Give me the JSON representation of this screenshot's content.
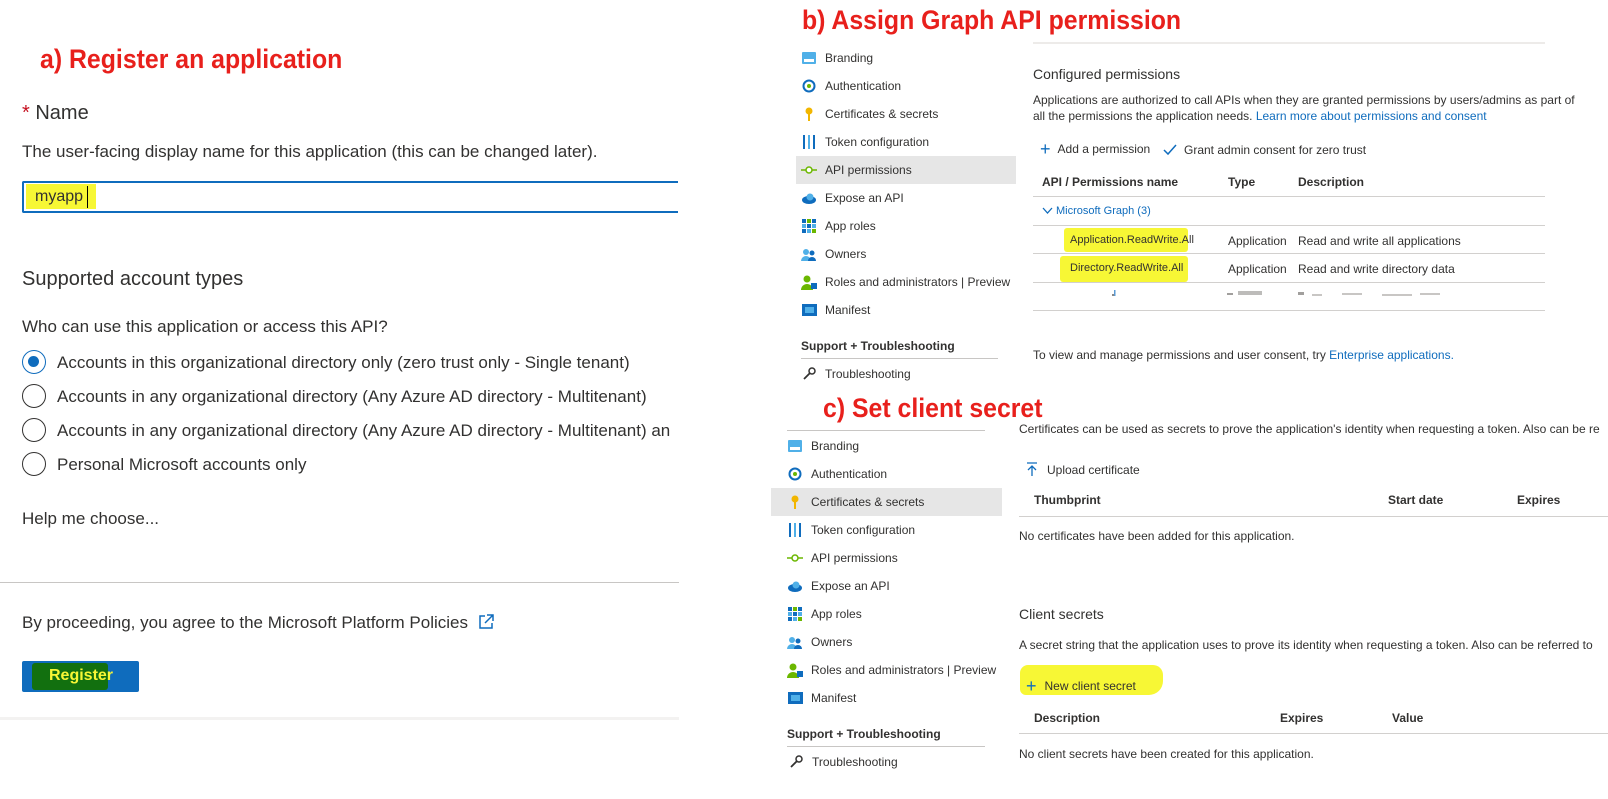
{
  "panel_a": {
    "title": "a) Register an application",
    "name_required_star": "*",
    "name_label": "Name",
    "name_help": "The user-facing display name for this application (this can be changed later).",
    "name_value": "myapp",
    "account_types_heading": "Supported account types",
    "account_types_question": "Who can use this application or access this API?",
    "account_options": [
      {
        "label": "Accounts in this organizational directory only (zero trust only - Single tenant)",
        "checked": true
      },
      {
        "label": "Accounts in any organizational directory (Any Azure AD directory - Multitenant)",
        "checked": false
      },
      {
        "label": "Accounts in any organizational directory (Any Azure AD directory - Multitenant) an",
        "checked": false
      },
      {
        "label": "Personal Microsoft accounts only",
        "checked": false
      }
    ],
    "help_link": "Help me choose...",
    "policy_text": "By proceeding, you agree to the Microsoft Platform Policies",
    "register_label": "Register"
  },
  "panel_b": {
    "title": "b) Assign Graph API permission",
    "nav_items": [
      {
        "label": "Branding",
        "icon": "branding-icon",
        "selected": false
      },
      {
        "label": "Authentication",
        "icon": "authentication-icon",
        "selected": false
      },
      {
        "label": "Certificates & secrets",
        "icon": "key-icon",
        "selected": false
      },
      {
        "label": "Token configuration",
        "icon": "token-icon",
        "selected": false
      },
      {
        "label": "API permissions",
        "icon": "api-permissions-icon",
        "selected": true
      },
      {
        "label": "Expose an API",
        "icon": "cloud-icon",
        "selected": false
      },
      {
        "label": "App roles",
        "icon": "app-roles-icon",
        "selected": false
      },
      {
        "label": "Owners",
        "icon": "owners-icon",
        "selected": false
      },
      {
        "label": "Roles and administrators | Preview",
        "icon": "roles-icon",
        "selected": false
      },
      {
        "label": "Manifest",
        "icon": "manifest-icon",
        "selected": false
      }
    ],
    "support_heading": "Support + Troubleshooting",
    "troubleshooting": "Troubleshooting",
    "configured_title": "Configured permissions",
    "configured_desc_1": "Applications are authorized to call APIs when they are granted permissions by users/admins as part of",
    "configured_desc_2": "all the permissions the application needs.",
    "learn_more": "Learn more about permissions and consent",
    "add_permission": "Add a permission",
    "grant_consent": "Grant admin consent for zero trust",
    "col_name": "API / Permissions name",
    "col_type": "Type",
    "col_desc": "Description",
    "group": "Microsoft Graph (3)",
    "permissions": [
      {
        "name": "Application.ReadWrite.All",
        "type": "Application",
        "desc": "Read and write all applications"
      },
      {
        "name": "Directory.ReadWrite.All",
        "type": "Application",
        "desc": "Read and write directory data"
      }
    ],
    "footer_text": "To view and manage permissions and user consent, try",
    "footer_link": "Enterprise applications."
  },
  "panel_c": {
    "title": "c) Set client secret",
    "nav_items": [
      {
        "label": "Branding",
        "icon": "branding-icon",
        "selected": false
      },
      {
        "label": "Authentication",
        "icon": "authentication-icon",
        "selected": false
      },
      {
        "label": "Certificates & secrets",
        "icon": "key-icon",
        "selected": true
      },
      {
        "label": "Token configuration",
        "icon": "token-icon",
        "selected": false
      },
      {
        "label": "API permissions",
        "icon": "api-permissions-icon",
        "selected": false
      },
      {
        "label": "Expose an API",
        "icon": "cloud-icon",
        "selected": false
      },
      {
        "label": "App roles",
        "icon": "app-roles-icon",
        "selected": false
      },
      {
        "label": "Owners",
        "icon": "owners-icon",
        "selected": false
      },
      {
        "label": "Roles and administrators | Preview",
        "icon": "roles-icon",
        "selected": false
      },
      {
        "label": "Manifest",
        "icon": "manifest-icon",
        "selected": false
      }
    ],
    "support_heading": "Support + Troubleshooting",
    "troubleshooting": "Troubleshooting",
    "cert_desc": "Certificates can be used as secrets to prove the application's identity when requesting a token. Also can be re",
    "upload_certificate": "Upload certificate",
    "cert_cols": [
      "Thumbprint",
      "Start date",
      "Expires"
    ],
    "no_certs": "No certificates have been added for this application.",
    "secrets_title": "Client secrets",
    "secrets_desc": "A secret string that the application uses to prove its identity when requesting a token. Also can be referred to",
    "new_secret": "New client secret",
    "secret_cols": [
      "Description",
      "Expires",
      "Value"
    ],
    "no_secrets": "No client secrets have been created for this application."
  },
  "colors": {
    "accent": "#0f6cbd",
    "annotation_red": "#e8201c",
    "highlight_yellow": "#f7f735",
    "register_green": "#12700f"
  }
}
